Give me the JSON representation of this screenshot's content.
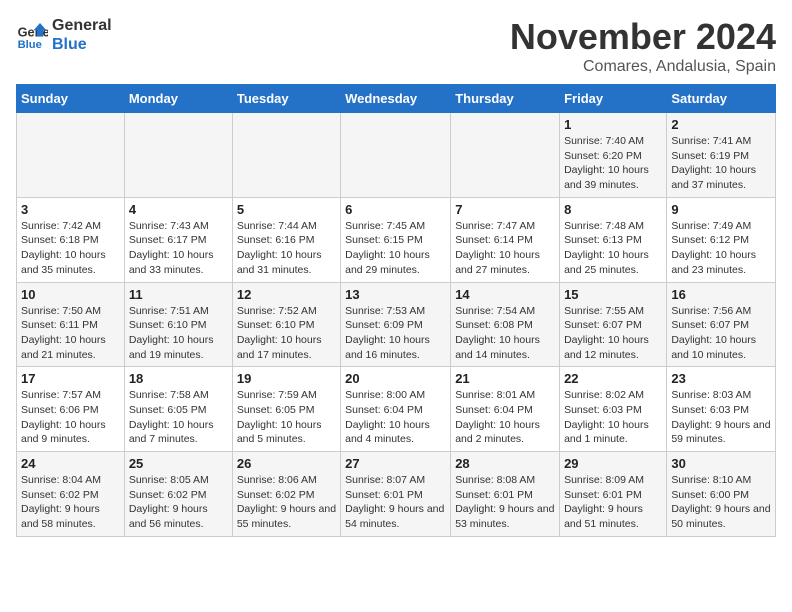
{
  "header": {
    "logo_line1": "General",
    "logo_line2": "Blue",
    "month_year": "November 2024",
    "location": "Comares, Andalusia, Spain"
  },
  "days_of_week": [
    "Sunday",
    "Monday",
    "Tuesday",
    "Wednesday",
    "Thursday",
    "Friday",
    "Saturday"
  ],
  "weeks": [
    [
      {
        "day": "",
        "info": ""
      },
      {
        "day": "",
        "info": ""
      },
      {
        "day": "",
        "info": ""
      },
      {
        "day": "",
        "info": ""
      },
      {
        "day": "",
        "info": ""
      },
      {
        "day": "1",
        "info": "Sunrise: 7:40 AM\nSunset: 6:20 PM\nDaylight: 10 hours and 39 minutes."
      },
      {
        "day": "2",
        "info": "Sunrise: 7:41 AM\nSunset: 6:19 PM\nDaylight: 10 hours and 37 minutes."
      }
    ],
    [
      {
        "day": "3",
        "info": "Sunrise: 7:42 AM\nSunset: 6:18 PM\nDaylight: 10 hours and 35 minutes."
      },
      {
        "day": "4",
        "info": "Sunrise: 7:43 AM\nSunset: 6:17 PM\nDaylight: 10 hours and 33 minutes."
      },
      {
        "day": "5",
        "info": "Sunrise: 7:44 AM\nSunset: 6:16 PM\nDaylight: 10 hours and 31 minutes."
      },
      {
        "day": "6",
        "info": "Sunrise: 7:45 AM\nSunset: 6:15 PM\nDaylight: 10 hours and 29 minutes."
      },
      {
        "day": "7",
        "info": "Sunrise: 7:47 AM\nSunset: 6:14 PM\nDaylight: 10 hours and 27 minutes."
      },
      {
        "day": "8",
        "info": "Sunrise: 7:48 AM\nSunset: 6:13 PM\nDaylight: 10 hours and 25 minutes."
      },
      {
        "day": "9",
        "info": "Sunrise: 7:49 AM\nSunset: 6:12 PM\nDaylight: 10 hours and 23 minutes."
      }
    ],
    [
      {
        "day": "10",
        "info": "Sunrise: 7:50 AM\nSunset: 6:11 PM\nDaylight: 10 hours and 21 minutes."
      },
      {
        "day": "11",
        "info": "Sunrise: 7:51 AM\nSunset: 6:10 PM\nDaylight: 10 hours and 19 minutes."
      },
      {
        "day": "12",
        "info": "Sunrise: 7:52 AM\nSunset: 6:10 PM\nDaylight: 10 hours and 17 minutes."
      },
      {
        "day": "13",
        "info": "Sunrise: 7:53 AM\nSunset: 6:09 PM\nDaylight: 10 hours and 16 minutes."
      },
      {
        "day": "14",
        "info": "Sunrise: 7:54 AM\nSunset: 6:08 PM\nDaylight: 10 hours and 14 minutes."
      },
      {
        "day": "15",
        "info": "Sunrise: 7:55 AM\nSunset: 6:07 PM\nDaylight: 10 hours and 12 minutes."
      },
      {
        "day": "16",
        "info": "Sunrise: 7:56 AM\nSunset: 6:07 PM\nDaylight: 10 hours and 10 minutes."
      }
    ],
    [
      {
        "day": "17",
        "info": "Sunrise: 7:57 AM\nSunset: 6:06 PM\nDaylight: 10 hours and 9 minutes."
      },
      {
        "day": "18",
        "info": "Sunrise: 7:58 AM\nSunset: 6:05 PM\nDaylight: 10 hours and 7 minutes."
      },
      {
        "day": "19",
        "info": "Sunrise: 7:59 AM\nSunset: 6:05 PM\nDaylight: 10 hours and 5 minutes."
      },
      {
        "day": "20",
        "info": "Sunrise: 8:00 AM\nSunset: 6:04 PM\nDaylight: 10 hours and 4 minutes."
      },
      {
        "day": "21",
        "info": "Sunrise: 8:01 AM\nSunset: 6:04 PM\nDaylight: 10 hours and 2 minutes."
      },
      {
        "day": "22",
        "info": "Sunrise: 8:02 AM\nSunset: 6:03 PM\nDaylight: 10 hours and 1 minute."
      },
      {
        "day": "23",
        "info": "Sunrise: 8:03 AM\nSunset: 6:03 PM\nDaylight: 9 hours and 59 minutes."
      }
    ],
    [
      {
        "day": "24",
        "info": "Sunrise: 8:04 AM\nSunset: 6:02 PM\nDaylight: 9 hours and 58 minutes."
      },
      {
        "day": "25",
        "info": "Sunrise: 8:05 AM\nSunset: 6:02 PM\nDaylight: 9 hours and 56 minutes."
      },
      {
        "day": "26",
        "info": "Sunrise: 8:06 AM\nSunset: 6:02 PM\nDaylight: 9 hours and 55 minutes."
      },
      {
        "day": "27",
        "info": "Sunrise: 8:07 AM\nSunset: 6:01 PM\nDaylight: 9 hours and 54 minutes."
      },
      {
        "day": "28",
        "info": "Sunrise: 8:08 AM\nSunset: 6:01 PM\nDaylight: 9 hours and 53 minutes."
      },
      {
        "day": "29",
        "info": "Sunrise: 8:09 AM\nSunset: 6:01 PM\nDaylight: 9 hours and 51 minutes."
      },
      {
        "day": "30",
        "info": "Sunrise: 8:10 AM\nSunset: 6:00 PM\nDaylight: 9 hours and 50 minutes."
      }
    ]
  ]
}
